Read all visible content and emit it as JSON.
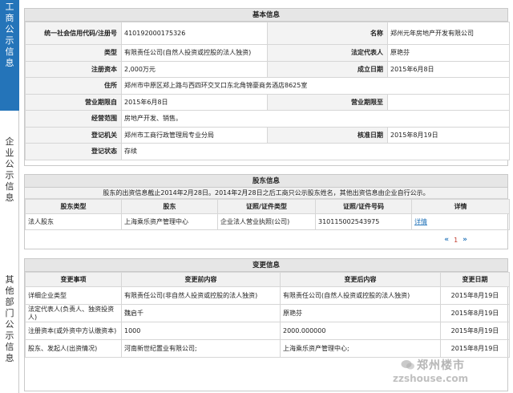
{
  "vtabs": [
    {
      "label": "工商公示信息",
      "active": true
    },
    {
      "label": "企业公示信息",
      "active": false
    },
    {
      "label": "其他部门公示信息",
      "active": false
    }
  ],
  "basic": {
    "title": "基本信息",
    "rows": [
      {
        "l1": "统一社会信用代码/注册号",
        "v1": "410192000175326",
        "l2": "名称",
        "v2": "郑州元年房地产开发有限公司"
      },
      {
        "l1": "类型",
        "v1": "有限责任公司(自然人投资或控股的法人独资)",
        "l2": "法定代表人",
        "v2": "原艳芬"
      },
      {
        "l1": "注册资本",
        "v1": "2,000万元",
        "l2": "成立日期",
        "v2": "2015年6月8日"
      },
      {
        "l1": "住所",
        "v1": "郑州市中原区郑上路与西四环交叉口东北角锦豪商务酒店8625室"
      },
      {
        "l1": "营业期限自",
        "v1": "2015年6月8日",
        "l2": "营业期限至",
        "v2": ""
      },
      {
        "l1": "经营范围",
        "v1": "房地产开发、销售。"
      },
      {
        "l1": "登记机关",
        "v1": "郑州市工商行政管理局专业分局",
        "l2": "核准日期",
        "v2": "2015年8月19日"
      },
      {
        "l1": "登记状态",
        "v1": "存续"
      }
    ]
  },
  "holder": {
    "title": "股东信息",
    "notice": "股东的出资信息截止2014年2月28日。2014年2月28日之后工商只公示股东姓名，其他出资信息由企业自行公示。",
    "columns": [
      "股东类型",
      "股东",
      "证照/证件类型",
      "证照/证件号码",
      "详情"
    ],
    "rows": [
      {
        "type": "法人股东",
        "name": "上海乘乐资产管理中心",
        "cert_type": "企业法人营业执照(公司)",
        "cert_no": "310115002543975",
        "detail": "详情"
      }
    ],
    "pager": {
      "prev": "«",
      "page": "1",
      "next": "»"
    }
  },
  "change": {
    "title": "变更信息",
    "columns": [
      "变更事项",
      "变更前内容",
      "变更后内容",
      "变更日期"
    ],
    "rows": [
      {
        "item": "详细企业类型",
        "before": "有限责任公司(非自然人投资或控股的法人独资)",
        "after": "有限责任公司(自然人投资或控股的法人独资)",
        "date": "2015年8月19日"
      },
      {
        "item": "法定代表人(负责人、独资投资人)",
        "before": "魏启千",
        "after": "原艳芬",
        "date": "2015年8月19日"
      },
      {
        "item": "注册资本(或外资中方认缴资本)",
        "before": "1000",
        "after": "2000.000000",
        "date": "2015年8月19日"
      },
      {
        "item": "股东、发起人(出资情况)",
        "before": "河南新世纪置业有限公司;",
        "after": "上海乘乐资产管理中心;",
        "date": "2015年8月19日"
      }
    ]
  },
  "watermark": {
    "line1": "郑州楼市",
    "line2": "zzshouse.com"
  }
}
